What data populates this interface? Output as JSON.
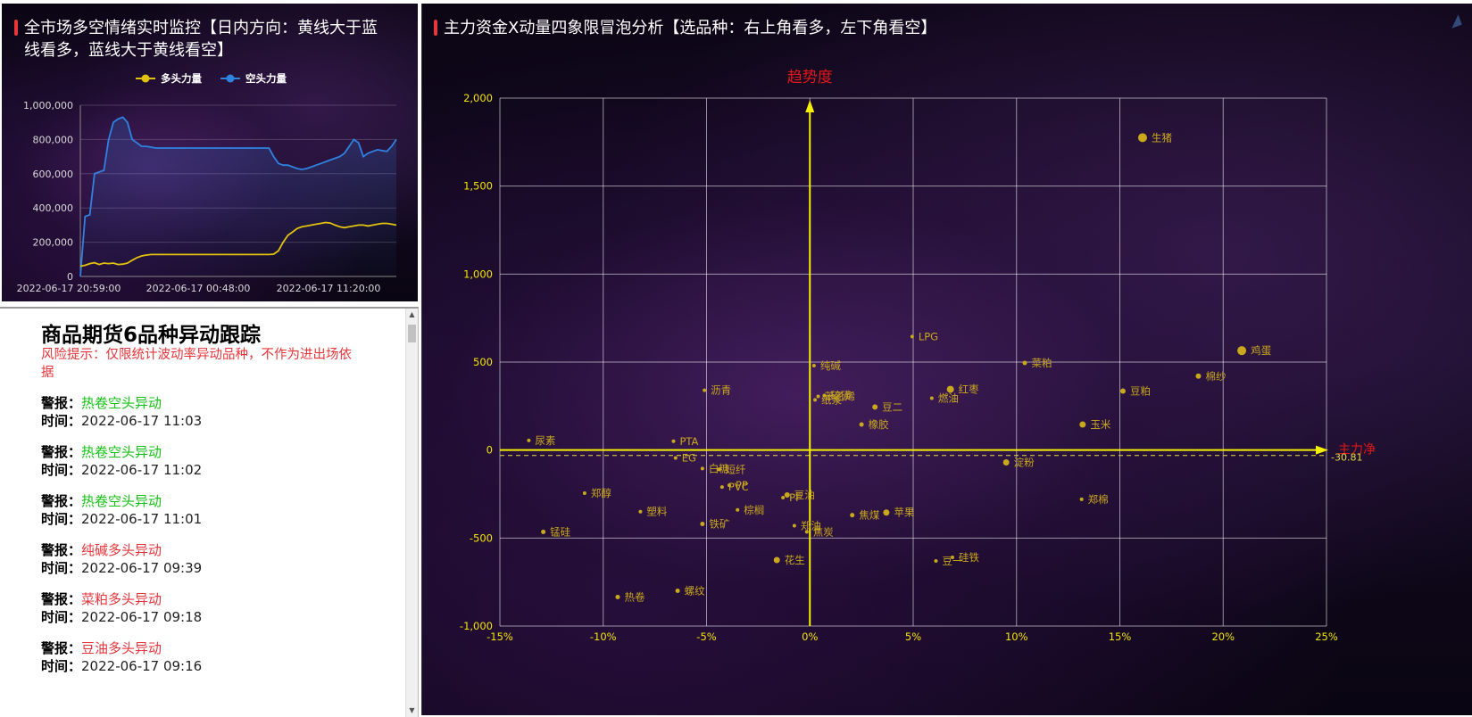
{
  "left_chart": {
    "title": "全市场多空情绪实时监控【日内方向：黄线大于蓝线看多，蓝线大于黄线看空】",
    "title_line1": "全市场多空情绪实时监控【日内方向：黄线大于蓝",
    "title_line2": "线看多，蓝线大于黄线看空】",
    "colors": {
      "long": "#e2c20c",
      "short": "#2f82e0"
    },
    "chart_data": {
      "type": "line",
      "series": [
        {
          "name": "多头力量",
          "color": "#e2c20c",
          "values": [
            60000,
            65000,
            75000,
            80000,
            70000,
            78000,
            75000,
            78000,
            70000,
            72000,
            78000,
            95000,
            110000,
            120000,
            125000,
            128000,
            128000,
            128000,
            128000,
            128000,
            128000,
            128000,
            128000,
            128000,
            128000,
            128000,
            128000,
            128000,
            128000,
            128000,
            128000,
            128000,
            128000,
            128000,
            128000,
            128000,
            128000,
            128000,
            128000,
            128000,
            128000,
            130000,
            150000,
            200000,
            240000,
            260000,
            280000,
            290000,
            295000,
            300000,
            305000,
            310000,
            315000,
            312000,
            300000,
            290000,
            285000,
            290000,
            295000,
            300000,
            300000,
            295000,
            300000,
            305000,
            310000,
            310000,
            305000,
            300000
          ]
        },
        {
          "name": "空头力量",
          "color": "#2f82e0",
          "values": [
            0,
            350000,
            360000,
            600000,
            610000,
            620000,
            800000,
            900000,
            920000,
            930000,
            900000,
            800000,
            780000,
            760000,
            760000,
            755000,
            750000,
            750000,
            750000,
            750000,
            750000,
            750000,
            750000,
            750000,
            750000,
            750000,
            750000,
            750000,
            750000,
            750000,
            750000,
            750000,
            750000,
            750000,
            750000,
            750000,
            750000,
            750000,
            750000,
            750000,
            750000,
            700000,
            660000,
            650000,
            650000,
            640000,
            630000,
            625000,
            630000,
            640000,
            650000,
            660000,
            670000,
            680000,
            690000,
            700000,
            720000,
            760000,
            800000,
            780000,
            700000,
            720000,
            730000,
            740000,
            735000,
            730000,
            760000,
            800000
          ]
        }
      ],
      "x_ticks": [
        "2022-06-17 20:59:00",
        "2022-06-17 00:48:00",
        "2022-06-17 11:20:00"
      ],
      "y_ticks": [
        "0",
        "200,000",
        "400,000",
        "600,000",
        "800,000",
        "1,000,000"
      ],
      "ylim": [
        0,
        1000000
      ]
    }
  },
  "alerts": {
    "heading": "商品期货6品种异动跟踪",
    "risk_note": "风险提示：仅限统计波动率异动品种，不作为进出场依据",
    "alert_label": "警报：",
    "time_label": "时间：",
    "items": [
      {
        "name": "热卷空头异动",
        "type": "short",
        "time": "2022-06-17 11:03"
      },
      {
        "name": "热卷空头异动",
        "type": "short",
        "time": "2022-06-17 11:02"
      },
      {
        "name": "热卷空头异动",
        "type": "short",
        "time": "2022-06-17 11:01"
      },
      {
        "name": "纯碱多头异动",
        "type": "long",
        "time": "2022-06-17 09:39"
      },
      {
        "name": "菜粕多头异动",
        "type": "long",
        "time": "2022-06-17 09:18"
      },
      {
        "name": "豆油多头异动",
        "type": "long",
        "time": "2022-06-17 09:16"
      }
    ]
  },
  "right_chart": {
    "title": "主力资金X动量四象限冒泡分析【选品种：右上角看多，左下角看空】",
    "chart_data": {
      "type": "scatter",
      "y_axis_name": "趋势度",
      "x_axis_name": "主力净",
      "xlim": [
        -15,
        25
      ],
      "ylim": [
        -1000,
        2000
      ],
      "x_ticks": [
        "-15%",
        "-10%",
        "-5%",
        "0%",
        "5%",
        "10%",
        "15%",
        "20%",
        "25%"
      ],
      "y_ticks": [
        "-1,000",
        "-500",
        "0",
        "500",
        "1,000",
        "1,500",
        "2,000"
      ],
      "mark_line": {
        "value": -30.81,
        "label": "-30.81"
      },
      "points": [
        {
          "name": "生猪",
          "x": 16.1,
          "y": 1775,
          "size": 5
        },
        {
          "name": "鸡蛋",
          "x": 20.9,
          "y": 565,
          "size": 5
        },
        {
          "name": "LPG",
          "x": 4.95,
          "y": 645,
          "size": 2
        },
        {
          "name": "菜粕",
          "x": 10.4,
          "y": 495,
          "size": 2.5
        },
        {
          "name": "棉纱",
          "x": 18.8,
          "y": 420,
          "size": 3
        },
        {
          "name": "纯碱",
          "x": 0.2,
          "y": 480,
          "size": 2
        },
        {
          "name": "红枣",
          "x": 6.8,
          "y": 345,
          "size": 4
        },
        {
          "name": "豆粕",
          "x": 15.15,
          "y": 335,
          "size": 3
        },
        {
          "name": "沥青",
          "x": -5.1,
          "y": 340,
          "size": 2
        },
        {
          "name": "苯乙烯",
          "x": 0.4,
          "y": 305,
          "size": 2
        },
        {
          "name": "硫磺",
          "x": 0.7,
          "y": 310,
          "size": 2
        },
        {
          "name": "纸浆",
          "x": 0.25,
          "y": 285,
          "size": 2
        },
        {
          "name": "燃油",
          "x": 5.9,
          "y": 295,
          "size": 2
        },
        {
          "name": "豆二",
          "x": 3.15,
          "y": 245,
          "size": 3
        },
        {
          "name": "玉米",
          "x": 13.2,
          "y": 145,
          "size": 3.5
        },
        {
          "name": "橡胶",
          "x": 2.5,
          "y": 145,
          "size": 2.5
        },
        {
          "name": "尿素",
          "x": -13.6,
          "y": 55,
          "size": 2
        },
        {
          "name": "PTA",
          "x": -6.6,
          "y": 50,
          "size": 2
        },
        {
          "name": "EG",
          "x": -6.5,
          "y": -45,
          "size": 2
        },
        {
          "name": "淀粉",
          "x": 9.5,
          "y": -70,
          "size": 3.5
        },
        {
          "name": "白糖",
          "x": -5.2,
          "y": -105,
          "size": 2
        },
        {
          "name": "短纤",
          "x": -4.4,
          "y": -110,
          "size": 2
        },
        {
          "name": "郑醇",
          "x": -10.9,
          "y": -245,
          "size": 2
        },
        {
          "name": "PVC",
          "x": -4.25,
          "y": -210,
          "size": 2
        },
        {
          "name": "PP",
          "x": -3.9,
          "y": -200,
          "size": 2
        },
        {
          "name": "豆油",
          "x": -1.1,
          "y": -255,
          "size": 3
        },
        {
          "name": "PF",
          "x": -1.3,
          "y": -270,
          "size": 2
        },
        {
          "name": "郑棉",
          "x": 13.15,
          "y": -280,
          "size": 2
        },
        {
          "name": "塑料",
          "x": -8.2,
          "y": -350,
          "size": 2
        },
        {
          "name": "棕榈",
          "x": -3.5,
          "y": -340,
          "size": 2
        },
        {
          "name": "苹果",
          "x": 3.7,
          "y": -355,
          "size": 3.5
        },
        {
          "name": "焦煤",
          "x": 2.05,
          "y": -370,
          "size": 2.5
        },
        {
          "name": "铁矿",
          "x": -5.2,
          "y": -420,
          "size": 2.5
        },
        {
          "name": "郑油",
          "x": -0.75,
          "y": -430,
          "size": 2
        },
        {
          "name": "焦炭",
          "x": -0.15,
          "y": -465,
          "size": 2
        },
        {
          "name": "锰硅",
          "x": -12.9,
          "y": -465,
          "size": 2.5
        },
        {
          "name": "花生",
          "x": -1.6,
          "y": -625,
          "size": 3.5
        },
        {
          "name": "豆一",
          "x": 6.1,
          "y": -630,
          "size": 2
        },
        {
          "name": "硅铁",
          "x": 6.9,
          "y": -610,
          "size": 2
        },
        {
          "name": "螺纹",
          "x": -6.4,
          "y": -800,
          "size": 2.5
        },
        {
          "name": "热卷",
          "x": -9.3,
          "y": -835,
          "size": 2.5
        }
      ]
    }
  }
}
